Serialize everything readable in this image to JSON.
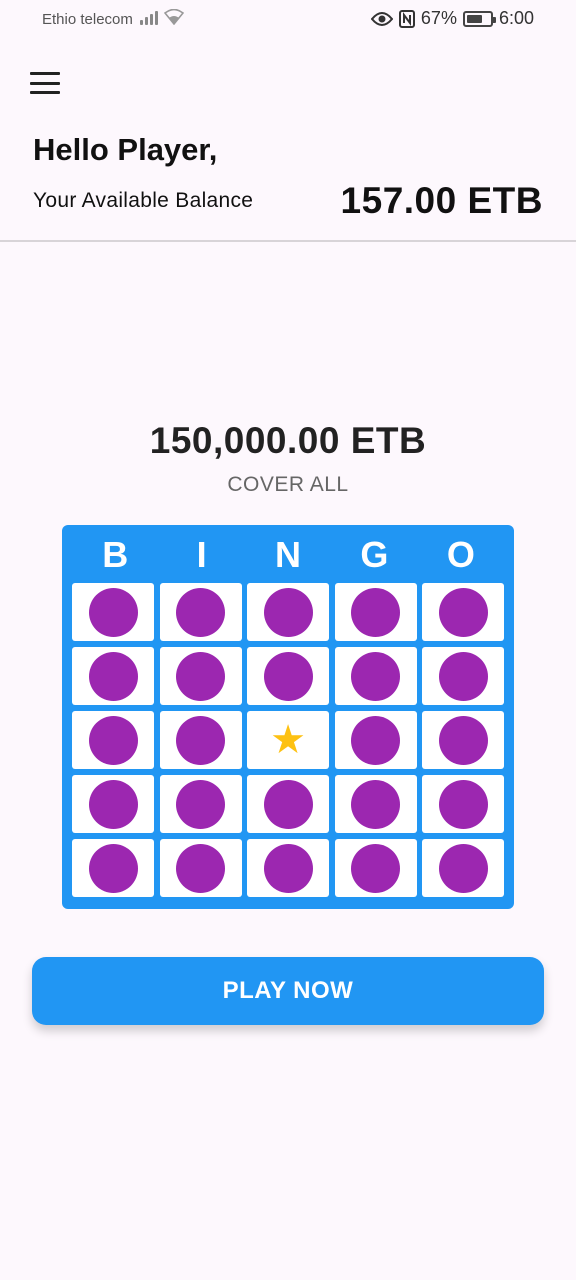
{
  "status_bar": {
    "carrier": "Ethio telecom",
    "battery": "67%",
    "battery_level": 0.67,
    "time": "6:00"
  },
  "header": {
    "greeting": "Hello Player,",
    "balance_label": "Your Available Balance",
    "balance_value": "157.00 ETB"
  },
  "game": {
    "prize": "150,000.00 ETB",
    "pattern": "COVER ALL",
    "letters": [
      "B",
      "I",
      "N",
      "G",
      "O"
    ],
    "free_cell_symbol": "★",
    "card_color": "#2196f3",
    "marker_color": "#9c27b0",
    "star_color": "#fdc112"
  },
  "actions": {
    "play_label": "PLAY NOW"
  }
}
